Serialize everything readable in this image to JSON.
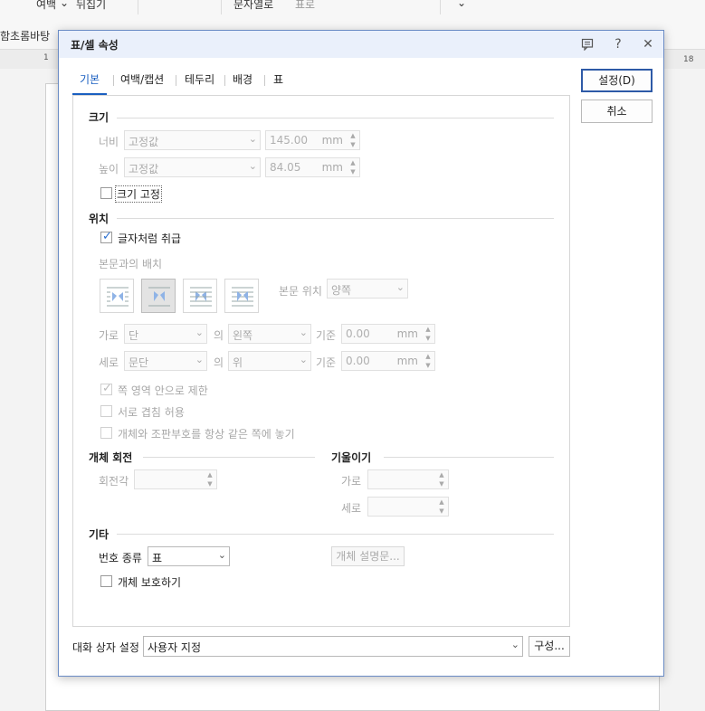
{
  "app": {
    "toolbar": {
      "margin_label": "여백",
      "flip_label": "뒤집기",
      "doc_style_label": "문자열로",
      "table_label": "표로",
      "background_label": "함초롬바탕"
    },
    "ruler": {
      "left_num": "1",
      "right_num": "18"
    }
  },
  "dialog": {
    "title": "표/셀 속성",
    "help_glyph": "?",
    "close_glyph": "✕",
    "tabs": [
      "기본",
      "여백/캡션",
      "테두리",
      "배경",
      "표"
    ],
    "buttons": {
      "ok": "설정(D)",
      "cancel": "취소"
    },
    "size": {
      "section": "크기",
      "width_label": "너비",
      "width_mode": "고정값",
      "width_value": "145.00",
      "height_label": "높이",
      "height_mode": "고정값",
      "height_value": "84.05",
      "unit": "mm",
      "fixed_label": "크기 고정",
      "fixed_checked": false
    },
    "position": {
      "section": "위치",
      "treat_as_char": "글자처럼 취급",
      "treat_as_char_checked": true,
      "wrap_label": "본문과의 배치",
      "body_pos_label": "본문 위치",
      "body_pos_value": "양쪽",
      "horiz_label": "가로",
      "horiz_rel": "단",
      "horiz_of": "의",
      "horiz_align": "왼쪽",
      "horiz_base": "기준",
      "horiz_value": "0.00",
      "vert_label": "세로",
      "vert_rel": "문단",
      "vert_of": "의",
      "vert_align": "위",
      "vert_base": "기준",
      "vert_value": "0.00",
      "unit": "mm",
      "limit_page": "쪽 영역 안으로 제한",
      "allow_overlap": "서로 겹침 허용",
      "keep_same_page": "개체와 조판부호를 항상 같은 쪽에 놓기"
    },
    "rotation": {
      "section": "개체 회전",
      "angle_label": "회전각"
    },
    "skew": {
      "section": "기울이기",
      "horiz_label": "가로",
      "vert_label": "세로"
    },
    "etc": {
      "section": "기타",
      "number_type_label": "번호 종류",
      "number_type_value": "표",
      "desc_button": "개체 설명문...",
      "protect_label": "개체 보호하기"
    },
    "footer": {
      "setting_label": "대화 상자 설정",
      "setting_value": "사용자 지정",
      "config_button": "구성..."
    }
  }
}
